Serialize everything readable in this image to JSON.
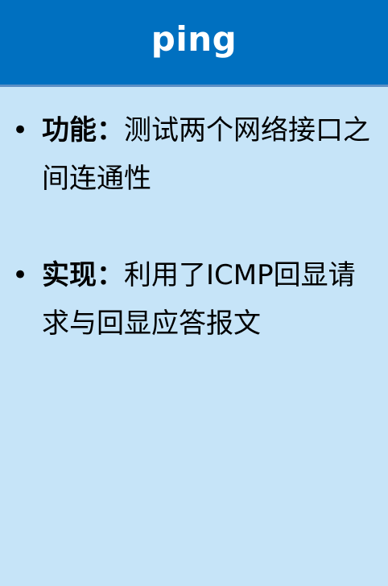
{
  "header": {
    "title": "ping"
  },
  "bullets": [
    {
      "marker": "•",
      "label": "功能：",
      "text": "测试两个网络接口之间连通性"
    },
    {
      "marker": "•",
      "label": "实现：",
      "text": "利用了ICMP回显请求与回显应答报文"
    }
  ],
  "colors": {
    "header_bg": "#0070c0",
    "header_border": "#5d8fc4",
    "body_bg": "#c6e4f8",
    "title_text": "#ffffff",
    "body_text": "#000000"
  }
}
